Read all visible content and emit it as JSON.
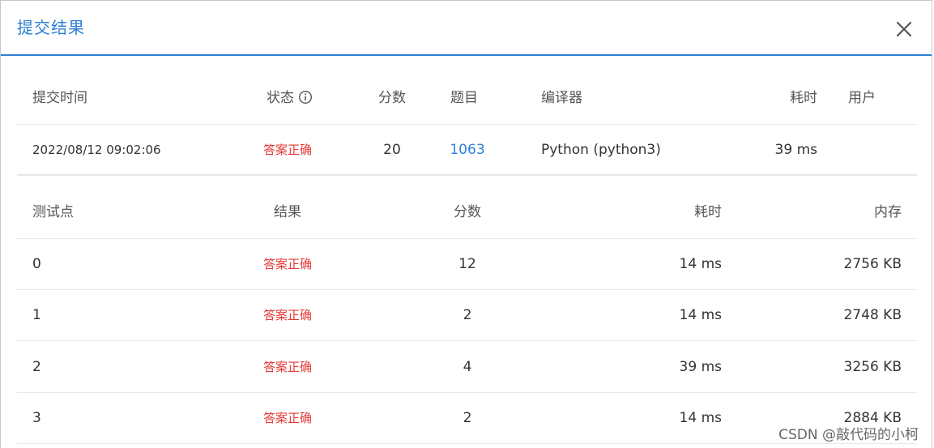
{
  "dialog": {
    "title": "提交结果"
  },
  "summary": {
    "headers": {
      "time": "提交时间",
      "status": "状态",
      "score": "分数",
      "problem": "题目",
      "compiler": "编译器",
      "elapsed": "耗时",
      "user": "用户"
    },
    "row": {
      "time": "2022/08/12 09:02:06",
      "status": "答案正确",
      "score": "20",
      "problem": "1063",
      "compiler": "Python (python3)",
      "elapsed": "39 ms",
      "user": ""
    }
  },
  "testcases": {
    "headers": {
      "case": "测试点",
      "result": "结果",
      "score": "分数",
      "elapsed": "耗时",
      "memory": "内存"
    },
    "rows": [
      {
        "case": "0",
        "result": "答案正确",
        "score": "12",
        "elapsed": "14 ms",
        "memory": "2756 KB"
      },
      {
        "case": "1",
        "result": "答案正确",
        "score": "2",
        "elapsed": "14 ms",
        "memory": "2748 KB"
      },
      {
        "case": "2",
        "result": "答案正确",
        "score": "4",
        "elapsed": "39 ms",
        "memory": "3256 KB"
      },
      {
        "case": "3",
        "result": "答案正确",
        "score": "2",
        "elapsed": "14 ms",
        "memory": "2884 KB"
      }
    ]
  },
  "watermark": "CSDN @敲代码的小柯",
  "colors": {
    "accent": "#2d7fd6",
    "success_text": "#e53935"
  },
  "icons": {
    "status_info": "info-circle-icon",
    "close": "close-icon"
  }
}
